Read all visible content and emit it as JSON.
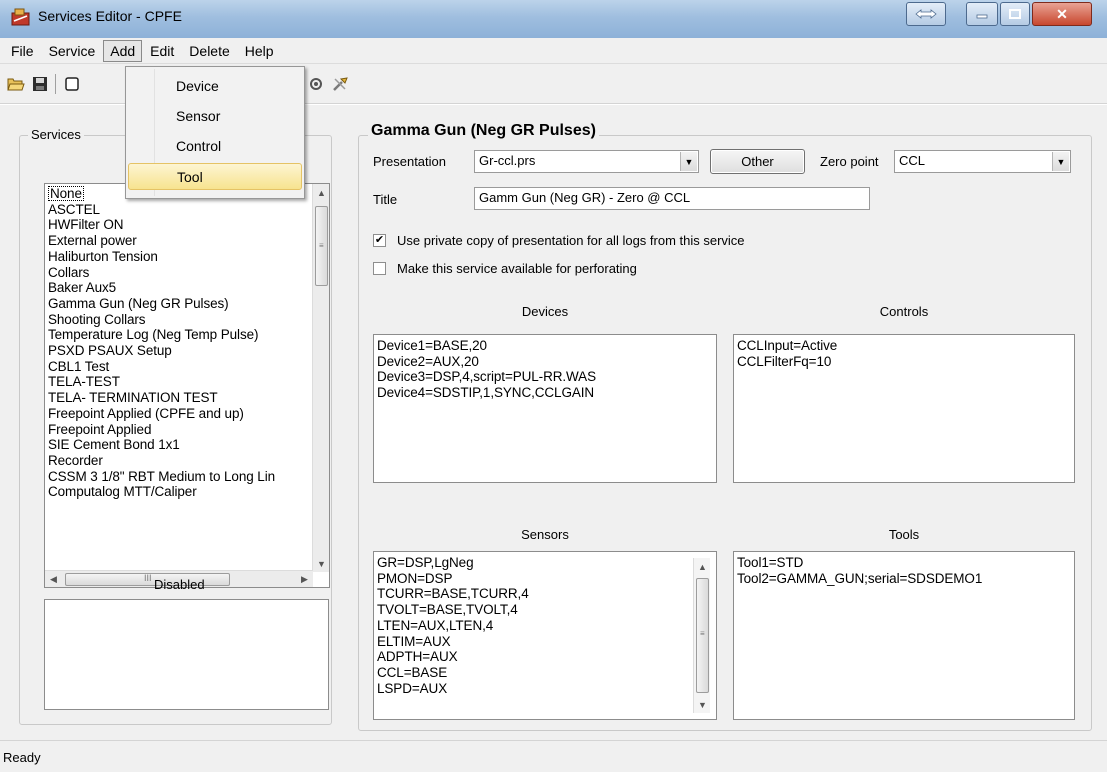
{
  "window": {
    "title": "Services Editor - CPFE"
  },
  "menu": {
    "items": [
      "File",
      "Service",
      "Add",
      "Edit",
      "Delete",
      "Help"
    ],
    "active": "Add",
    "add_dropdown": [
      "Device",
      "Sensor",
      "Control",
      "Tool"
    ],
    "highlighted": "Tool"
  },
  "toolbar": {
    "icons": [
      "open-folder-icon",
      "save-icon",
      "new-document-icon",
      "tool-settings-icon",
      "tools-wrench-icon"
    ]
  },
  "services": {
    "group_label": "Services",
    "items": [
      "None",
      "ASCTEL",
      "HWFilter ON",
      "External power",
      "Haliburton Tension",
      "Collars",
      "Baker Aux5",
      "Gamma Gun (Neg GR Pulses)",
      "Shooting Collars",
      "Temperature Log (Neg Temp Pulse)",
      "PSXD PSAUX Setup",
      "CBL1 Test",
      "TELA-TEST",
      "TELA- TERMINATION TEST",
      "Freepoint Applied (CPFE and up)",
      "Freepoint Applied",
      "SIE Cement Bond 1x1",
      "Recorder",
      "CSSM 3 1/8\" RBT Medium to Long Lin",
      "Computalog MTT/Caliper"
    ],
    "selected": "None",
    "disabled_label": "Disabled"
  },
  "detail": {
    "group_label": "Gamma Gun (Neg GR Pulses)",
    "presentation_label": "Presentation",
    "presentation_value": "Gr-ccl.prs",
    "other_button": "Other",
    "zero_point_label": "Zero point",
    "zero_point_value": "CCL",
    "title_label": "Title",
    "title_value": "Gamm Gun (Neg GR) - Zero @ CCL",
    "private_copy_label": "Use private copy of presentation for all logs from this service",
    "private_copy_checked": true,
    "perforating_label": "Make this service available for perforating",
    "perforating_checked": false,
    "devices_label": "Devices",
    "devices": [
      "Device1=BASE,20",
      "Device2=AUX,20",
      "Device3=DSP,4,script=PUL-RR.WAS",
      "Device4=SDSTIP,1,SYNC,CCLGAIN"
    ],
    "controls_label": "Controls",
    "controls": [
      "CCLInput=Active",
      "CCLFilterFq=10"
    ],
    "sensors_label": "Sensors",
    "sensors": [
      "GR=DSP,LgNeg",
      "PMON=DSP",
      "TCURR=BASE,TCURR,4",
      "TVOLT=BASE,TVOLT,4",
      "LTEN=AUX,LTEN,4",
      "ELTIM=AUX",
      "ADPTH=AUX",
      "CCL=BASE",
      "LSPD=AUX"
    ],
    "tools_label": "Tools",
    "tools": [
      "Tool1=STD",
      "Tool2=GAMMA_GUN;serial=SDSDEMO1"
    ]
  },
  "status": {
    "text": "Ready"
  },
  "colors": {
    "titlebar": "#9fbedf",
    "menu_highlight": "#f7e38f",
    "window_bg": "#f0f0f0"
  }
}
